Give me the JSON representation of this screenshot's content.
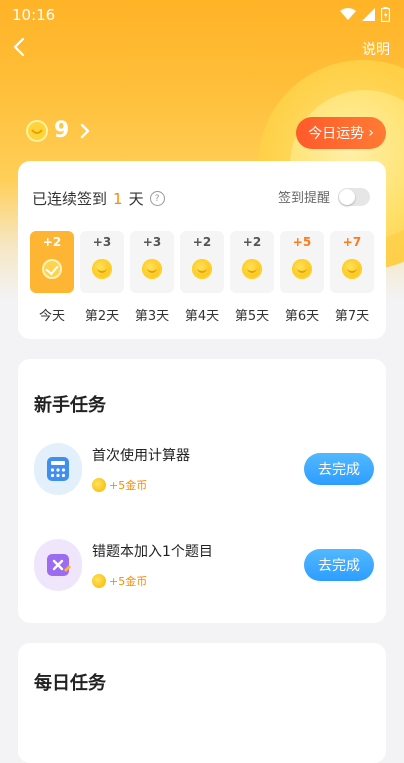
{
  "status": {
    "time": "10:16"
  },
  "header": {
    "help_label": "说明"
  },
  "coins": {
    "count": "9"
  },
  "fortune_button": {
    "label": "今日运势",
    "chevron": "›"
  },
  "checkin": {
    "streak_prefix": "已连续签到",
    "streak_days": "1",
    "streak_suffix": "天",
    "help_glyph": "?",
    "reminder_label": "签到提醒",
    "reminder_on": false,
    "days": [
      {
        "label": "今天",
        "points": "+2"
      },
      {
        "label": "第2天",
        "points": "+3"
      },
      {
        "label": "第3天",
        "points": "+3"
      },
      {
        "label": "第4天",
        "points": "+2"
      },
      {
        "label": "第5天",
        "points": "+2"
      },
      {
        "label": "第6天",
        "points": "+5"
      },
      {
        "label": "第7天",
        "points": "+7"
      }
    ]
  },
  "newbie_tasks": {
    "title": "新手任务",
    "items": [
      {
        "title": "首次使用计算器",
        "reward": "+5金币",
        "button": "去完成"
      },
      {
        "title": "错题本加入1个题目",
        "reward": "+5金币",
        "button": "去完成"
      }
    ]
  },
  "daily_tasks": {
    "title": "每日任务"
  },
  "colors": {
    "accent": "#ffb534",
    "fortune": "#ff6a2e",
    "button_blue": "#2d9dff",
    "reward": "#ff8a00"
  }
}
